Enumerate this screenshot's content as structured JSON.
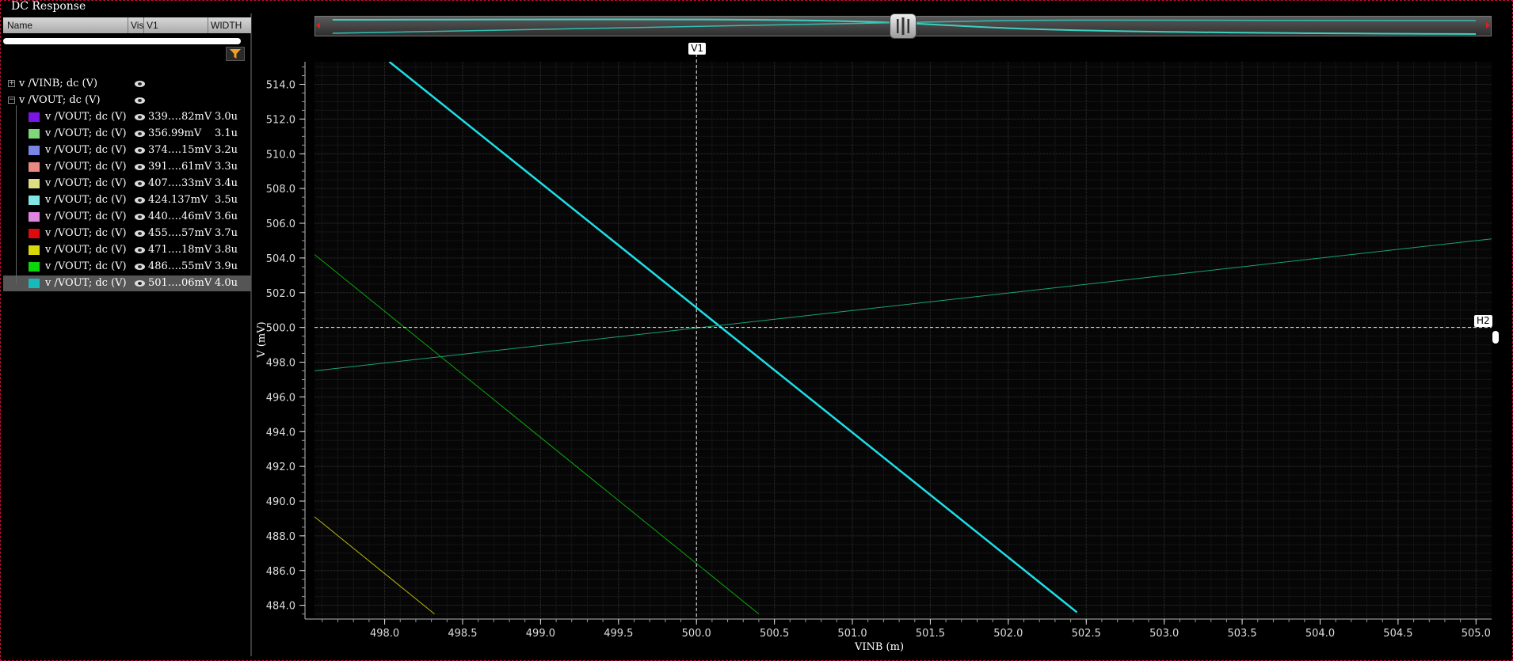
{
  "window": {
    "title": "DC Response"
  },
  "table": {
    "headers": {
      "name": "Name",
      "vis": "Vis",
      "v1": "V1",
      "width": "WIDTH"
    },
    "rows": [
      {
        "name": "v /VINB; dc (V)",
        "v1": "",
        "width": "",
        "expander": "+",
        "color": "",
        "level": 0
      },
      {
        "name": "v /VOUT; dc (V)",
        "v1": "",
        "width": "",
        "expander": "−",
        "color": "",
        "level": 0
      },
      {
        "name": "v /VOUT; dc (V)",
        "v1": "339….82mV",
        "width": "3.0u",
        "color": "#7a16e6",
        "level": 1
      },
      {
        "name": "v /VOUT; dc (V)",
        "v1": "356.99mV",
        "width": "3.1u",
        "color": "#7ed87a",
        "level": 1
      },
      {
        "name": "v /VOUT; dc (V)",
        "v1": "374….15mV",
        "width": "3.2u",
        "color": "#7a86e6",
        "level": 1
      },
      {
        "name": "v /VOUT; dc (V)",
        "v1": "391….61mV",
        "width": "3.3u",
        "color": "#e88a82",
        "level": 1
      },
      {
        "name": "v /VOUT; dc (V)",
        "v1": "407….33mV",
        "width": "3.4u",
        "color": "#dede82",
        "level": 1
      },
      {
        "name": "v /VOUT; dc (V)",
        "v1": "424.137mV",
        "width": "3.5u",
        "color": "#82e6e6",
        "level": 1
      },
      {
        "name": "v /VOUT; dc (V)",
        "v1": "440….46mV",
        "width": "3.6u",
        "color": "#e086de",
        "level": 1
      },
      {
        "name": "v /VOUT; dc (V)",
        "v1": "455….57mV",
        "width": "3.7u",
        "color": "#e00a0a",
        "level": 1
      },
      {
        "name": "v /VOUT; dc (V)",
        "v1": "471….18mV",
        "width": "3.8u",
        "color": "#d8d80a",
        "level": 1
      },
      {
        "name": "v /VOUT; dc (V)",
        "v1": "486….55mV",
        "width": "3.9u",
        "color": "#0ad80a",
        "level": 1
      },
      {
        "name": "v /VOUT; dc (V)",
        "v1": "501….06mV",
        "width": "4.0u",
        "color": "#19b9b9",
        "level": 1,
        "selected": true
      }
    ]
  },
  "cursors": {
    "vertical": "V1",
    "horizontal": "H2"
  },
  "chart_data": {
    "type": "line",
    "xlabel": "VINB (m)",
    "ylabel": "V (mV)",
    "xlim": [
      497.55,
      505.1
    ],
    "ylim": [
      483.3,
      515.3
    ],
    "xticks": [
      "498.0",
      "498.5",
      "499.0",
      "499.5",
      "500.0",
      "500.5",
      "501.0",
      "501.5",
      "502.0",
      "502.5",
      "503.0",
      "503.5",
      "504.0",
      "504.5",
      "505.0"
    ],
    "yticks": [
      "484.0",
      "486.0",
      "488.0",
      "490.0",
      "492.0",
      "494.0",
      "496.0",
      "498.0",
      "500.0",
      "502.0",
      "504.0",
      "506.0",
      "508.0",
      "510.0",
      "512.0",
      "514.0"
    ],
    "grid": true,
    "series": [
      {
        "color": "#1de0e8",
        "x": [
          498.03,
          502.44
        ],
        "y": [
          515.3,
          483.6
        ]
      },
      {
        "color": "#1aa07a",
        "x": [
          497.55,
          505.1
        ],
        "y": [
          497.5,
          505.1
        ]
      },
      {
        "color": "#0aa80a",
        "x": [
          497.55,
          500.4
        ],
        "y": [
          504.2,
          483.5
        ]
      },
      {
        "color": "#b8b80a",
        "x": [
          497.55,
          498.32
        ],
        "y": [
          489.1,
          483.5
        ]
      }
    ],
    "cursor_x": 500.0,
    "cursor_y": 500.0
  }
}
